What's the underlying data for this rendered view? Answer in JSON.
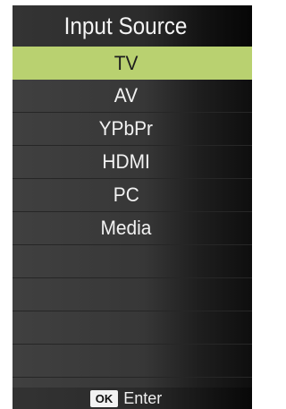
{
  "menu": {
    "title": "Input Source",
    "selected_index": 0,
    "items": [
      {
        "label": "TV"
      },
      {
        "label": "AV"
      },
      {
        "label": "YPbPr"
      },
      {
        "label": "HDMI"
      },
      {
        "label": "PC"
      },
      {
        "label": "Media"
      },
      {
        "label": ""
      },
      {
        "label": ""
      },
      {
        "label": ""
      },
      {
        "label": ""
      }
    ]
  },
  "footer": {
    "ok_key": "OK",
    "action_label": "Enter"
  },
  "colors": {
    "highlight": "#b9d170",
    "panel_background": "#404040",
    "text": "#f2f2f2"
  }
}
